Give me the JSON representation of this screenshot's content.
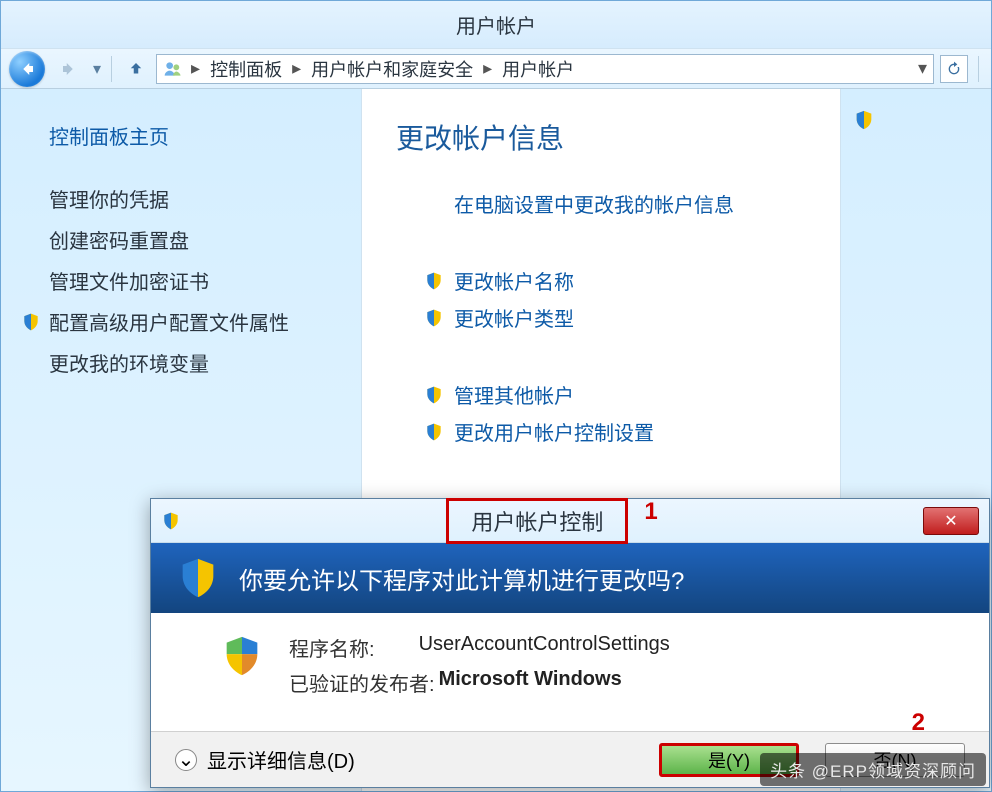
{
  "window": {
    "title": "用户帐户"
  },
  "nav": {
    "breadcrumbs": [
      "控制面板",
      "用户帐户和家庭安全",
      "用户帐户"
    ]
  },
  "sidebar": {
    "home": "控制面板主页",
    "links": [
      {
        "label": "管理你的凭据",
        "shield": false
      },
      {
        "label": "创建密码重置盘",
        "shield": false
      },
      {
        "label": "管理文件加密证书",
        "shield": false
      },
      {
        "label": "配置高级用户配置文件属性",
        "shield": true
      },
      {
        "label": "更改我的环境变量",
        "shield": false
      }
    ]
  },
  "main": {
    "heading": "更改帐户信息",
    "top_link": "在电脑设置中更改我的帐户信息",
    "actions1": [
      {
        "label": "更改帐户名称",
        "shield": true
      },
      {
        "label": "更改帐户类型",
        "shield": true
      }
    ],
    "actions2": [
      {
        "label": "管理其他帐户",
        "shield": true
      },
      {
        "label": "更改用户帐户控制设置",
        "shield": true
      }
    ]
  },
  "uac": {
    "title": "用户帐户控制",
    "annotation1": "1",
    "question": "你要允许以下程序对此计算机进行更改吗?",
    "program_label": "程序名称:",
    "program_value": "UserAccountControlSettings",
    "publisher_label": "已验证的发布者:",
    "publisher_value": "Microsoft Windows",
    "show_details": "显示详细信息(D)",
    "yes": "是(Y)",
    "no": "否(N)",
    "annotation2": "2",
    "close_glyph": "✕"
  },
  "watermark": "头条 @ERP领域资深顾问"
}
